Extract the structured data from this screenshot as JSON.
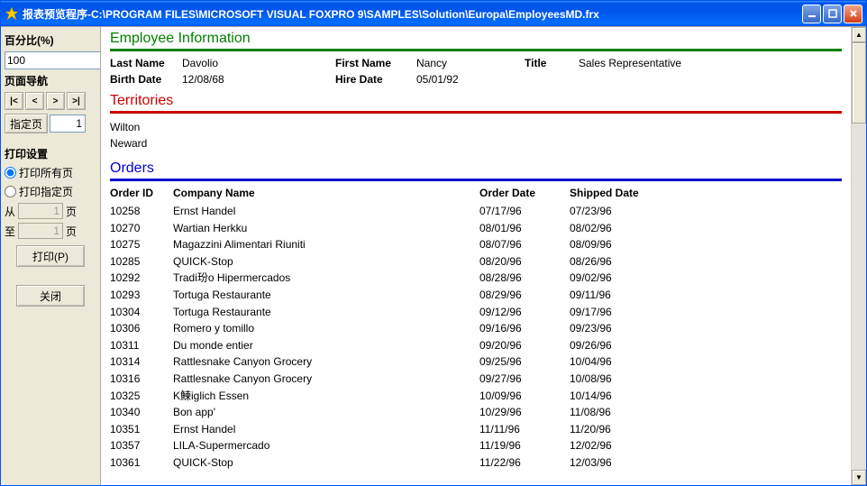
{
  "window": {
    "title": "报表预览程序-C:\\PROGRAM FILES\\MICROSOFT VISUAL FOXPRO 9\\SAMPLES\\Solution\\Europa\\EmployeesMD.frx"
  },
  "sidebar": {
    "percent_label": "百分比(%)",
    "percent_value": "100",
    "nav_label": "页面导航",
    "nav_first": "|<",
    "nav_prev": "<",
    "nav_next": ">",
    "nav_last": ">|",
    "goto_btn": "指定页",
    "goto_value": "1",
    "print_settings_label": "打印设置",
    "print_all": "打印所有页",
    "print_range": "打印指定页",
    "from_label": "从",
    "to_label": "至",
    "page_suffix": "页",
    "from_value": "1",
    "to_value": "1",
    "print_btn": "打印(P)",
    "close_btn": "关闭"
  },
  "report": {
    "emp_section": "Employee Information",
    "last_name_lbl": "Last Name",
    "last_name_val": "Davolio",
    "first_name_lbl": "First Name",
    "first_name_val": "Nancy",
    "title_lbl": "Title",
    "title_val": "Sales Representative",
    "birth_lbl": "Birth Date",
    "birth_val": "12/08/68",
    "hire_lbl": "Hire Date",
    "hire_val": "05/01/92",
    "terr_section": "Territories",
    "territories": [
      "Wilton",
      "Neward"
    ],
    "orders_section": "Orders",
    "orders_cols": {
      "id": "Order ID",
      "company": "Company Name",
      "order_date": "Order Date",
      "shipped": "Shipped Date"
    },
    "orders": [
      {
        "id": "10258",
        "company": "Ernst Handel",
        "od": "07/17/96",
        "sd": "07/23/96"
      },
      {
        "id": "10270",
        "company": "Wartian Herkku",
        "od": "08/01/96",
        "sd": "08/02/96"
      },
      {
        "id": "10275",
        "company": "Magazzini Alimentari Riuniti",
        "od": "08/07/96",
        "sd": "08/09/96"
      },
      {
        "id": "10285",
        "company": "QUICK-Stop",
        "od": "08/20/96",
        "sd": "08/26/96"
      },
      {
        "id": "10292",
        "company": "Tradi玢o Hipermercados",
        "od": "08/28/96",
        "sd": "09/02/96"
      },
      {
        "id": "10293",
        "company": "Tortuga Restaurante",
        "od": "08/29/96",
        "sd": "09/11/96"
      },
      {
        "id": "10304",
        "company": "Tortuga Restaurante",
        "od": "09/12/96",
        "sd": "09/17/96"
      },
      {
        "id": "10306",
        "company": "Romero y tomillo",
        "od": "09/16/96",
        "sd": "09/23/96"
      },
      {
        "id": "10311",
        "company": "Du monde entier",
        "od": "09/20/96",
        "sd": "09/26/96"
      },
      {
        "id": "10314",
        "company": "Rattlesnake Canyon Grocery",
        "od": "09/25/96",
        "sd": "10/04/96"
      },
      {
        "id": "10316",
        "company": "Rattlesnake Canyon Grocery",
        "od": "09/27/96",
        "sd": "10/08/96"
      },
      {
        "id": "10325",
        "company": "K鰊iglich Essen",
        "od": "10/09/96",
        "sd": "10/14/96"
      },
      {
        "id": "10340",
        "company": "Bon app'",
        "od": "10/29/96",
        "sd": "11/08/96"
      },
      {
        "id": "10351",
        "company": "Ernst Handel",
        "od": "11/11/96",
        "sd": "11/20/96"
      },
      {
        "id": "10357",
        "company": "LILA-Supermercado",
        "od": "11/19/96",
        "sd": "12/02/96"
      },
      {
        "id": "10361",
        "company": "QUICK-Stop",
        "od": "11/22/96",
        "sd": "12/03/96"
      }
    ]
  }
}
